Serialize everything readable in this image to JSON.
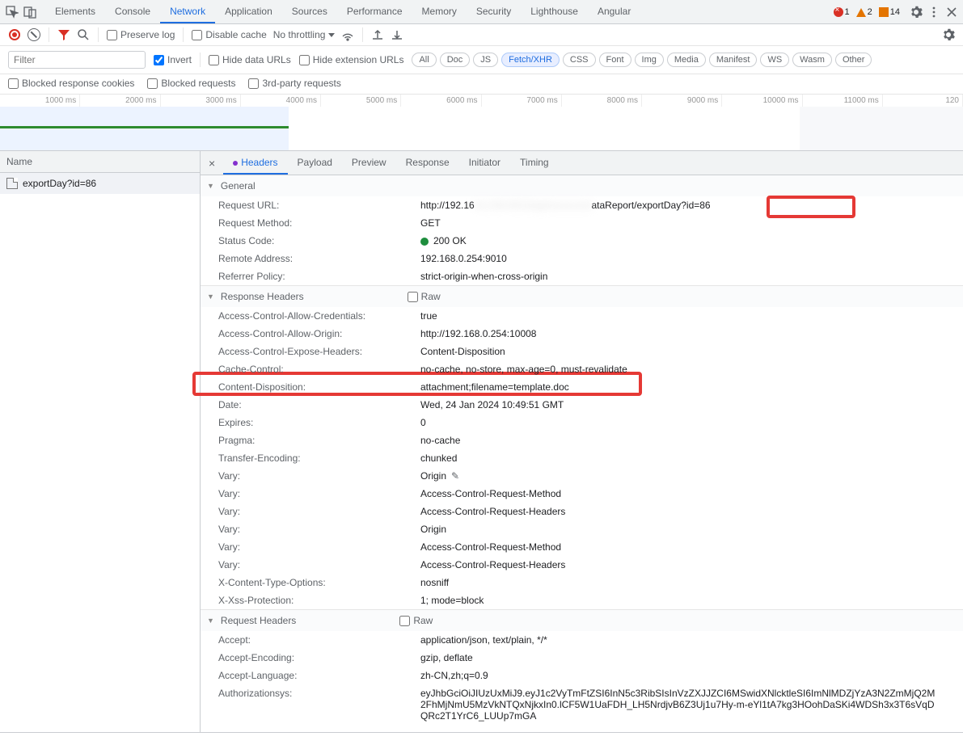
{
  "topbar": {
    "tabs": [
      "Elements",
      "Console",
      "Network",
      "Application",
      "Sources",
      "Performance",
      "Memory",
      "Security",
      "Lighthouse",
      "Angular"
    ],
    "active_tab": "Network",
    "errors": "1",
    "warnings": "2",
    "messages": "14"
  },
  "toolbar": {
    "preserve_log": "Preserve log",
    "disable_cache": "Disable cache",
    "throttling": "No throttling"
  },
  "filters": {
    "filter_placeholder": "Filter",
    "invert": "Invert",
    "hide_data_urls": "Hide data URLs",
    "hide_ext_urls": "Hide extension URLs",
    "chips": [
      "All",
      "Doc",
      "JS",
      "Fetch/XHR",
      "CSS",
      "Font",
      "Img",
      "Media",
      "Manifest",
      "WS",
      "Wasm",
      "Other"
    ],
    "active_chip": "Fetch/XHR",
    "blocked_cookies": "Blocked response cookies",
    "blocked_requests": "Blocked requests",
    "third_party": "3rd-party requests"
  },
  "timeline": {
    "ticks": [
      "1000 ms",
      "2000 ms",
      "3000 ms",
      "4000 ms",
      "5000 ms",
      "6000 ms",
      "7000 ms",
      "8000 ms",
      "9000 ms",
      "10000 ms",
      "11000 ms",
      "120"
    ]
  },
  "reqlist": {
    "header": "Name",
    "items": [
      {
        "name": "exportDay?id=86"
      }
    ]
  },
  "details": {
    "tabs": [
      "Headers",
      "Payload",
      "Preview",
      "Response",
      "Initiator",
      "Timing"
    ],
    "active_tab": "Headers",
    "general_label": "General",
    "general": [
      {
        "k": "Request URL:",
        "v_prefix": "http://192.16",
        "v_blur": "8.0.254:9010/api/xxxxxxx/d",
        "v_suffix": "ataReport/exportDay?id=86"
      },
      {
        "k": "Request Method:",
        "v": "GET"
      },
      {
        "k": "Status Code:",
        "v": "200 OK",
        "status": true
      },
      {
        "k": "Remote Address:",
        "v": "192.168.0.254:9010"
      },
      {
        "k": "Referrer Policy:",
        "v": "strict-origin-when-cross-origin"
      }
    ],
    "response_headers_label": "Response Headers",
    "raw_label": "Raw",
    "response_headers": [
      {
        "k": "Access-Control-Allow-Credentials:",
        "v": "true"
      },
      {
        "k": "Access-Control-Allow-Origin:",
        "v": "http://192.168.0.254:10008"
      },
      {
        "k": "Access-Control-Expose-Headers:",
        "v": "Content-Disposition"
      },
      {
        "k": "Cache-Control:",
        "v": "no-cache, no-store, max-age=0, must-revalidate"
      },
      {
        "k": "Content-Disposition:",
        "v": "attachment;filename=template.doc"
      },
      {
        "k": "Date:",
        "v": "Wed, 24 Jan 2024 10:49:51 GMT"
      },
      {
        "k": "Expires:",
        "v": "0"
      },
      {
        "k": "Pragma:",
        "v": "no-cache"
      },
      {
        "k": "Transfer-Encoding:",
        "v": "chunked"
      },
      {
        "k": "Vary:",
        "v": "Origin",
        "pencil": true
      },
      {
        "k": "Vary:",
        "v": "Access-Control-Request-Method"
      },
      {
        "k": "Vary:",
        "v": "Access-Control-Request-Headers"
      },
      {
        "k": "Vary:",
        "v": "Origin"
      },
      {
        "k": "Vary:",
        "v": "Access-Control-Request-Method"
      },
      {
        "k": "Vary:",
        "v": "Access-Control-Request-Headers"
      },
      {
        "k": "X-Content-Type-Options:",
        "v": "nosniff"
      },
      {
        "k": "X-Xss-Protection:",
        "v": "1; mode=block"
      }
    ],
    "request_headers_label": "Request Headers",
    "request_headers": [
      {
        "k": "Accept:",
        "v": "application/json, text/plain, */*"
      },
      {
        "k": "Accept-Encoding:",
        "v": "gzip, deflate"
      },
      {
        "k": "Accept-Language:",
        "v": "zh-CN,zh;q=0.9"
      },
      {
        "k": "Authorizationsys:",
        "v": "eyJhbGciOiJIUzUxMiJ9.eyJ1c2VyTmFtZSI6InN5c3RibSIsInVzZXJJZCI6MSwidXNlcktleSI6ImNlMDZjYzA3N2ZmMjQ2M2FhMjNmU5MzVkNTQxNjkxIn0.lCF5W1UaFDH_LH5NrdjvB6Z3Uj1u7Hy-m-eYl1tA7kg3HOohDaSKi4WDSh3x3T6sVqDQRc2T1YrC6_LUUp7mGA"
      }
    ]
  }
}
